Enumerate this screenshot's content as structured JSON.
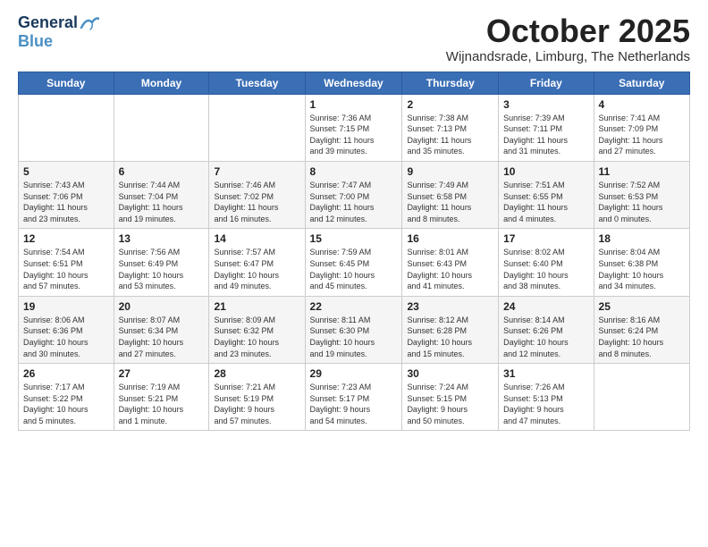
{
  "header": {
    "logo_general": "General",
    "logo_blue": "Blue",
    "month_title": "October 2025",
    "location": "Wijnandsrade, Limburg, The Netherlands"
  },
  "weekdays": [
    "Sunday",
    "Monday",
    "Tuesday",
    "Wednesday",
    "Thursday",
    "Friday",
    "Saturday"
  ],
  "weeks": [
    [
      {
        "day": "",
        "info": ""
      },
      {
        "day": "",
        "info": ""
      },
      {
        "day": "",
        "info": ""
      },
      {
        "day": "1",
        "info": "Sunrise: 7:36 AM\nSunset: 7:15 PM\nDaylight: 11 hours\nand 39 minutes."
      },
      {
        "day": "2",
        "info": "Sunrise: 7:38 AM\nSunset: 7:13 PM\nDaylight: 11 hours\nand 35 minutes."
      },
      {
        "day": "3",
        "info": "Sunrise: 7:39 AM\nSunset: 7:11 PM\nDaylight: 11 hours\nand 31 minutes."
      },
      {
        "day": "4",
        "info": "Sunrise: 7:41 AM\nSunset: 7:09 PM\nDaylight: 11 hours\nand 27 minutes."
      }
    ],
    [
      {
        "day": "5",
        "info": "Sunrise: 7:43 AM\nSunset: 7:06 PM\nDaylight: 11 hours\nand 23 minutes."
      },
      {
        "day": "6",
        "info": "Sunrise: 7:44 AM\nSunset: 7:04 PM\nDaylight: 11 hours\nand 19 minutes."
      },
      {
        "day": "7",
        "info": "Sunrise: 7:46 AM\nSunset: 7:02 PM\nDaylight: 11 hours\nand 16 minutes."
      },
      {
        "day": "8",
        "info": "Sunrise: 7:47 AM\nSunset: 7:00 PM\nDaylight: 11 hours\nand 12 minutes."
      },
      {
        "day": "9",
        "info": "Sunrise: 7:49 AM\nSunset: 6:58 PM\nDaylight: 11 hours\nand 8 minutes."
      },
      {
        "day": "10",
        "info": "Sunrise: 7:51 AM\nSunset: 6:55 PM\nDaylight: 11 hours\nand 4 minutes."
      },
      {
        "day": "11",
        "info": "Sunrise: 7:52 AM\nSunset: 6:53 PM\nDaylight: 11 hours\nand 0 minutes."
      }
    ],
    [
      {
        "day": "12",
        "info": "Sunrise: 7:54 AM\nSunset: 6:51 PM\nDaylight: 10 hours\nand 57 minutes."
      },
      {
        "day": "13",
        "info": "Sunrise: 7:56 AM\nSunset: 6:49 PM\nDaylight: 10 hours\nand 53 minutes."
      },
      {
        "day": "14",
        "info": "Sunrise: 7:57 AM\nSunset: 6:47 PM\nDaylight: 10 hours\nand 49 minutes."
      },
      {
        "day": "15",
        "info": "Sunrise: 7:59 AM\nSunset: 6:45 PM\nDaylight: 10 hours\nand 45 minutes."
      },
      {
        "day": "16",
        "info": "Sunrise: 8:01 AM\nSunset: 6:43 PM\nDaylight: 10 hours\nand 41 minutes."
      },
      {
        "day": "17",
        "info": "Sunrise: 8:02 AM\nSunset: 6:40 PM\nDaylight: 10 hours\nand 38 minutes."
      },
      {
        "day": "18",
        "info": "Sunrise: 8:04 AM\nSunset: 6:38 PM\nDaylight: 10 hours\nand 34 minutes."
      }
    ],
    [
      {
        "day": "19",
        "info": "Sunrise: 8:06 AM\nSunset: 6:36 PM\nDaylight: 10 hours\nand 30 minutes."
      },
      {
        "day": "20",
        "info": "Sunrise: 8:07 AM\nSunset: 6:34 PM\nDaylight: 10 hours\nand 27 minutes."
      },
      {
        "day": "21",
        "info": "Sunrise: 8:09 AM\nSunset: 6:32 PM\nDaylight: 10 hours\nand 23 minutes."
      },
      {
        "day": "22",
        "info": "Sunrise: 8:11 AM\nSunset: 6:30 PM\nDaylight: 10 hours\nand 19 minutes."
      },
      {
        "day": "23",
        "info": "Sunrise: 8:12 AM\nSunset: 6:28 PM\nDaylight: 10 hours\nand 15 minutes."
      },
      {
        "day": "24",
        "info": "Sunrise: 8:14 AM\nSunset: 6:26 PM\nDaylight: 10 hours\nand 12 minutes."
      },
      {
        "day": "25",
        "info": "Sunrise: 8:16 AM\nSunset: 6:24 PM\nDaylight: 10 hours\nand 8 minutes."
      }
    ],
    [
      {
        "day": "26",
        "info": "Sunrise: 7:17 AM\nSunset: 5:22 PM\nDaylight: 10 hours\nand 5 minutes."
      },
      {
        "day": "27",
        "info": "Sunrise: 7:19 AM\nSunset: 5:21 PM\nDaylight: 10 hours\nand 1 minute."
      },
      {
        "day": "28",
        "info": "Sunrise: 7:21 AM\nSunset: 5:19 PM\nDaylight: 9 hours\nand 57 minutes."
      },
      {
        "day": "29",
        "info": "Sunrise: 7:23 AM\nSunset: 5:17 PM\nDaylight: 9 hours\nand 54 minutes."
      },
      {
        "day": "30",
        "info": "Sunrise: 7:24 AM\nSunset: 5:15 PM\nDaylight: 9 hours\nand 50 minutes."
      },
      {
        "day": "31",
        "info": "Sunrise: 7:26 AM\nSunset: 5:13 PM\nDaylight: 9 hours\nand 47 minutes."
      },
      {
        "day": "",
        "info": ""
      }
    ]
  ]
}
